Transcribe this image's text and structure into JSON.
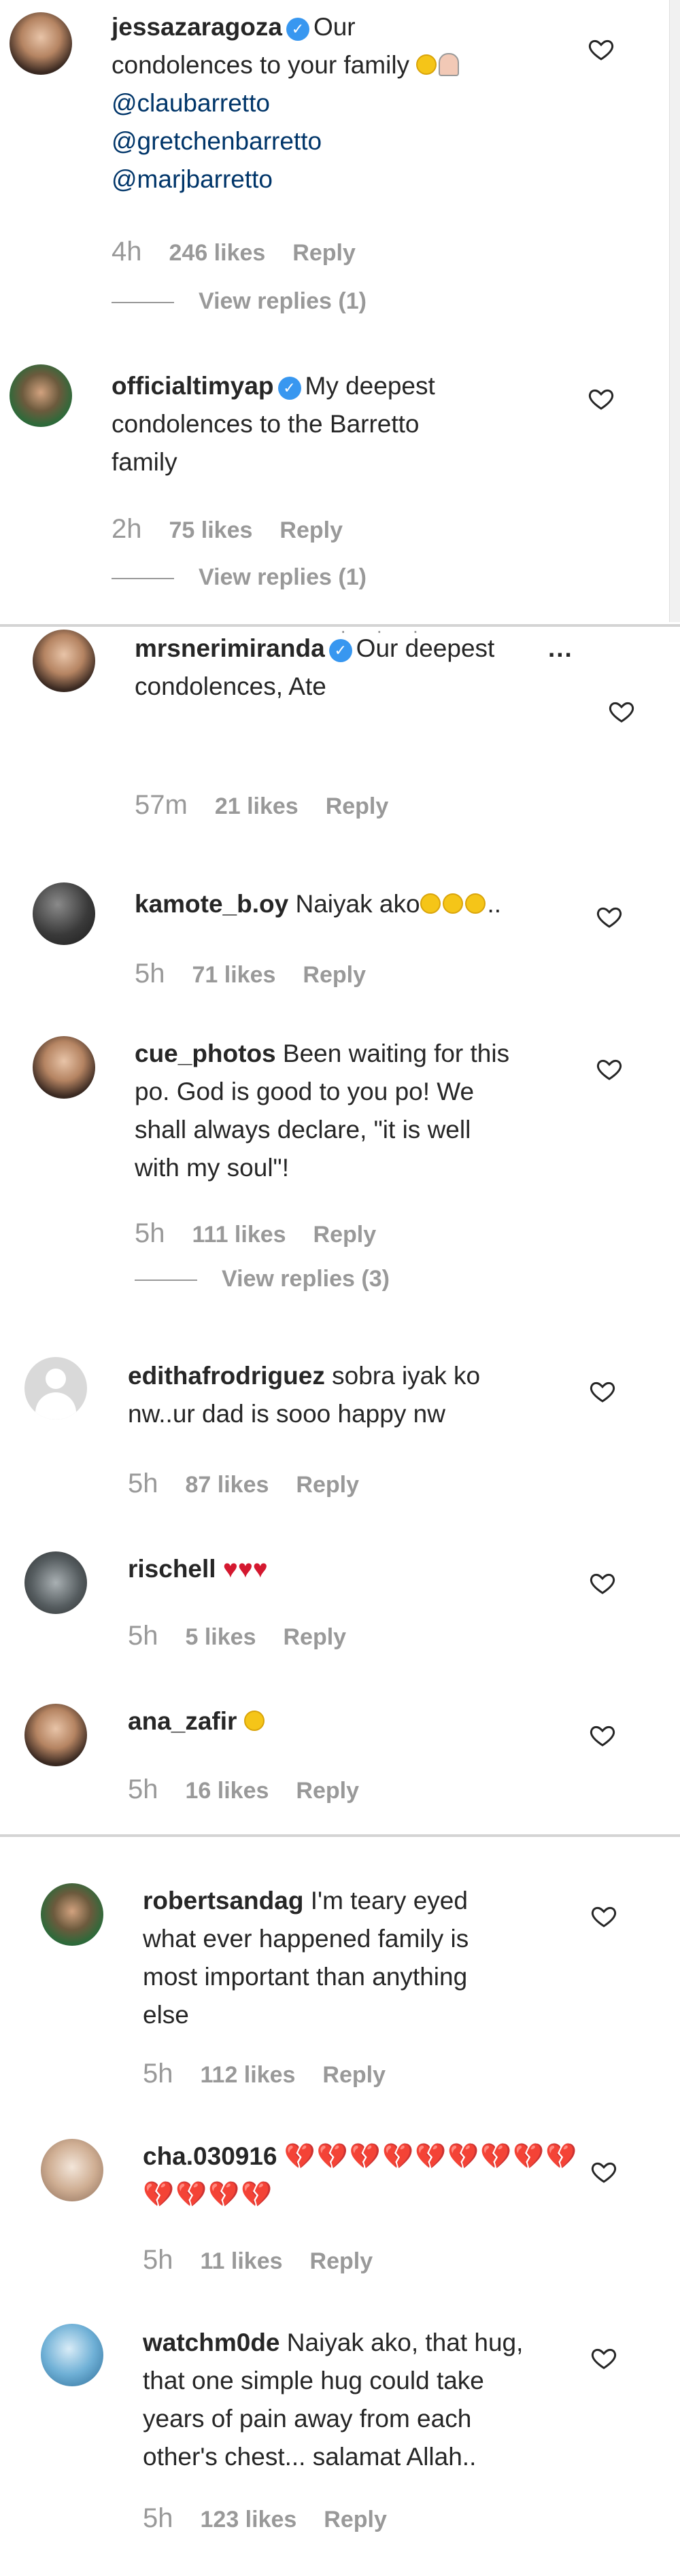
{
  "comments": [
    {
      "username": "jessazaragoza",
      "verified": true,
      "text_lines": [
        "Our",
        "condolences to your family"
      ],
      "mentions": [
        "@claubarretto",
        "@gretchenbarretto",
        "@marjbarretto"
      ],
      "time": "4h",
      "likes": "246 likes",
      "reply": "Reply",
      "view_replies": "View replies (1)"
    },
    {
      "username": "officialtimyap",
      "verified": true,
      "text_lines": [
        "My deepest",
        "condolences to the Barretto",
        "family"
      ],
      "time": "2h",
      "likes": "75 likes",
      "reply": "Reply",
      "view_replies": "View replies (1)"
    },
    {
      "username": "mrsnerimiranda",
      "verified": true,
      "text_lines": [
        "Our deepest",
        "condolences, Ate"
      ],
      "time": "57m",
      "likes": "21 likes",
      "reply": "Reply"
    },
    {
      "username": "kamote_b.oy",
      "text_lines": [
        "Naiyak ako",
        ".."
      ],
      "time": "5h",
      "likes": "71 likes",
      "reply": "Reply"
    },
    {
      "username": "cue_photos",
      "text_lines": [
        "Been waiting for this",
        "po. God is good to you po! We",
        "shall always declare, \"it is well",
        "with my soul\"!"
      ],
      "time": "5h",
      "likes": "111 likes",
      "reply": "Reply",
      "view_replies": "View replies (3)"
    },
    {
      "username": "edithafrodriguez",
      "text_lines": [
        "sobra iyak ko",
        "nw..ur dad is sooo happy nw"
      ],
      "time": "5h",
      "likes": "87 likes",
      "reply": "Reply"
    },
    {
      "username": "rischell",
      "text_lines": [
        "♥♥♥"
      ],
      "time": "5h",
      "likes": "5 likes",
      "reply": "Reply"
    },
    {
      "username": "ana_zafir",
      "text_lines": [
        ""
      ],
      "time": "5h",
      "likes": "16 likes",
      "reply": "Reply"
    },
    {
      "username": "robertsandag",
      "text_lines": [
        "I'm teary eyed",
        "what ever happened family is",
        "most important than anything",
        "else"
      ],
      "time": "5h",
      "likes": "112 likes",
      "reply": "Reply"
    },
    {
      "username": "cha.030916",
      "text_lines": [
        "",
        ""
      ],
      "time": "5h",
      "likes": "11 likes",
      "reply": "Reply"
    },
    {
      "username": "watchm0de",
      "text_lines": [
        "Naiyak ako, that hug,",
        "that one simple hug could take",
        "years of pain away from each",
        "other's chest... salamat Allah.."
      ],
      "time": "5h",
      "likes": "123 likes",
      "reply": "Reply"
    }
  ],
  "icons": {
    "heart": "heart-outline-icon",
    "verified": "verified-badge-icon",
    "more": "more-options-icon"
  },
  "colors": {
    "verified_blue": "#3897f0",
    "meta_gray": "#999999",
    "text": "#262626",
    "mention": "#003569"
  }
}
